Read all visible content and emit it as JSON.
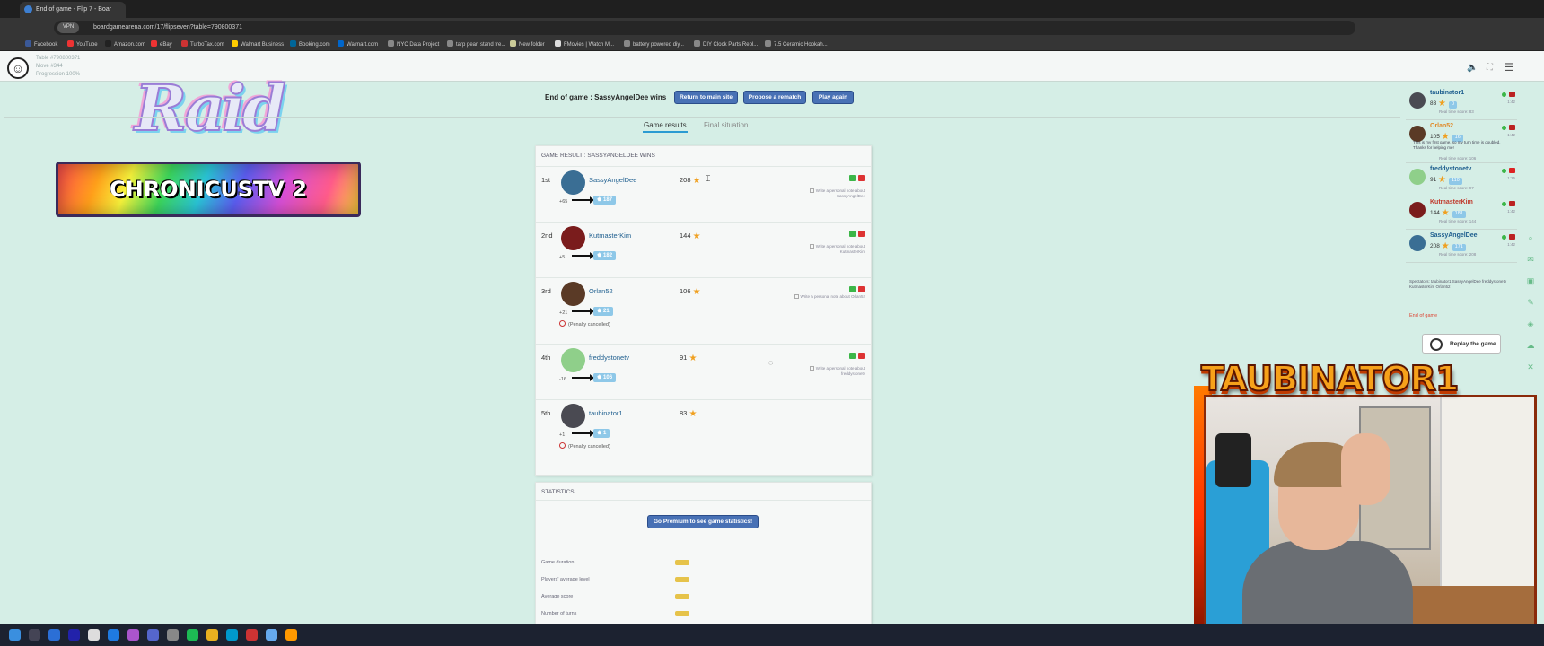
{
  "browser": {
    "tab_title": "End of game - Flip 7 - Boar",
    "url": "boardgamearena.com/17/flipseven?table=790800371",
    "pill": "VPN",
    "bookmarks": [
      "Facebook",
      "YouTube",
      "Amazon.com",
      "eBay",
      "TurboTax.com",
      "Walmart Business",
      "Booking.com",
      "Walmart.com",
      "NYC Data Project",
      "tarp pearl stand fre...",
      "New folder",
      "FMovies | Watch M...",
      "battery powered diy...",
      "DIY Clock Parts Repl...",
      "7.5 Ceramic Hookah..."
    ]
  },
  "table_info": {
    "table": "Table #790800371",
    "move": "Move #344",
    "progression": "Progression 100%"
  },
  "overlays": {
    "raid": "Raid",
    "channel": "CHRONICUSTV 2",
    "streamer": "TAUBINATOR1"
  },
  "header": {
    "end_text": "End of game : SassyAngelDee wins",
    "buttons": [
      "Return to main site",
      "Propose a rematch",
      "Play again"
    ],
    "tabs": [
      "Game results",
      "Final situation"
    ]
  },
  "results": {
    "title": "GAME RESULT : SASSYANGELDEE WINS",
    "rows": [
      {
        "rank": "1st",
        "name": "SassyAngelDee",
        "score": "208",
        "delta": "+65",
        "elo": "187",
        "note": "Write a personal note about SassyAngelDee",
        "penalty": "",
        "avatar": "#3a6e94"
      },
      {
        "rank": "2nd",
        "name": "KutmasterKim",
        "score": "144",
        "delta": "+5",
        "elo": "182",
        "note": "Write a personal note about KutmasterKim",
        "penalty": "",
        "avatar": "#7a1c1c"
      },
      {
        "rank": "3rd",
        "name": "Orlan52",
        "score": "106",
        "delta": "+21",
        "elo": "21",
        "note": "Write a personal note about Orlan52",
        "penalty": "(Penalty cancelled)",
        "avatar": "#5a3a26"
      },
      {
        "rank": "4th",
        "name": "freddystonetv",
        "score": "91",
        "delta": "-16",
        "elo": "106",
        "note": "Write a personal note about freddystonetv",
        "penalty": "",
        "avatar": "#8fcf8a"
      },
      {
        "rank": "5th",
        "name": "taubinator1",
        "score": "83",
        "delta": "+1",
        "elo": "1",
        "note": "",
        "penalty": "(Penalty cancelled)",
        "avatar": "#4a4a52"
      }
    ]
  },
  "statistics": {
    "title": "STATISTICS",
    "premium_button": "Go Premium to see game statistics!",
    "labels": [
      "Game duration",
      "Players' average level",
      "Average score",
      "Number of turns"
    ]
  },
  "sidebar": {
    "players": [
      {
        "name": "taubinator1",
        "score": "83",
        "elo": "0",
        "rt": "Real time score: 83",
        "time": "1:42",
        "msg": "",
        "avatar": "#4a4a52",
        "color": "#1f5f8f"
      },
      {
        "name": "Orlan52",
        "score": "105",
        "elo": "16",
        "rt": "Real time score: 106",
        "time": "1:42",
        "msg": "This is my first game, so my turn time is doubled. Thanks for helping me!",
        "avatar": "#5a3a26",
        "color": "#e08a2a"
      },
      {
        "name": "freddystonetv",
        "score": "91",
        "elo": "110",
        "rt": "Real time score: 97",
        "time": "1:25",
        "msg": "",
        "avatar": "#8fcf8a",
        "color": "#1f5f8f"
      },
      {
        "name": "KutmasterKim",
        "score": "144",
        "elo": "181",
        "rt": "Real time score: 144",
        "time": "1:42",
        "msg": "",
        "avatar": "#7a1c1c",
        "color": "#c0392b"
      },
      {
        "name": "SassyAngelDee",
        "score": "208",
        "elo": "171",
        "rt": "Real time score: 208",
        "time": "1:42",
        "msg": "",
        "avatar": "#3a6e94",
        "color": "#1f5f8f"
      }
    ],
    "spectators": "Spectators: taubinator1 SassyAngelDee freddystonetv KutmasterKim Orlan52",
    "end_of_game": "End of game",
    "replay": "Replay the game"
  },
  "colors": {
    "accent": "#4871b5",
    "background": "#d5eee6",
    "link": "#1f5f8f"
  }
}
